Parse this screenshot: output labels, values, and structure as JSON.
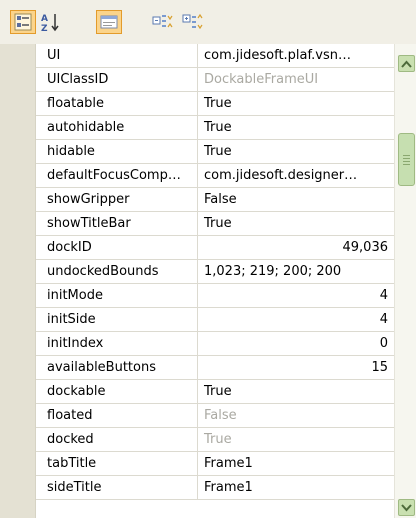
{
  "toolbar": {
    "buttons": [
      {
        "icon": "categorized-icon",
        "active": true
      },
      {
        "icon": "sort-alphabetical-icon",
        "active": false
      },
      {
        "icon": "description-toggle-icon",
        "active": true
      },
      {
        "icon": "expand-all-icon",
        "active": false
      },
      {
        "icon": "collapse-all-icon",
        "active": false
      }
    ]
  },
  "grid": {
    "rows": [
      {
        "name": "UI",
        "value": "com.jidesoft.plaf.vsn…",
        "align": "left",
        "gray": false
      },
      {
        "name": "UIClassID",
        "value": "DockableFrameUI",
        "align": "left",
        "gray": true
      },
      {
        "name": "floatable",
        "value": "True",
        "align": "left",
        "gray": false
      },
      {
        "name": "autohidable",
        "value": "True",
        "align": "left",
        "gray": false
      },
      {
        "name": "hidable",
        "value": "True",
        "align": "left",
        "gray": false
      },
      {
        "name": "defaultFocusComp…",
        "value": "com.jidesoft.designer…",
        "align": "left",
        "gray": false
      },
      {
        "name": "showGripper",
        "value": "False",
        "align": "left",
        "gray": false
      },
      {
        "name": "showTitleBar",
        "value": "True",
        "align": "left",
        "gray": false
      },
      {
        "name": "dockID",
        "value": "49,036",
        "align": "right",
        "gray": false
      },
      {
        "name": "undockedBounds",
        "value": "1,023; 219; 200; 200",
        "align": "left",
        "gray": false
      },
      {
        "name": "initMode",
        "value": "4",
        "align": "right",
        "gray": false
      },
      {
        "name": "initSide",
        "value": "4",
        "align": "right",
        "gray": false
      },
      {
        "name": "initIndex",
        "value": "0",
        "align": "right",
        "gray": false
      },
      {
        "name": "availableButtons",
        "value": "15",
        "align": "right",
        "gray": false
      },
      {
        "name": "dockable",
        "value": "True",
        "align": "left",
        "gray": false
      },
      {
        "name": "floated",
        "value": "False",
        "align": "left",
        "gray": true
      },
      {
        "name": "docked",
        "value": "True",
        "align": "left",
        "gray": true
      },
      {
        "name": "tabTitle",
        "value": "Frame1",
        "align": "left",
        "gray": false
      },
      {
        "name": "sideTitle",
        "value": "Frame1",
        "align": "left",
        "gray": false
      }
    ]
  },
  "colors": {
    "toolbar_bg": "#f1efe6",
    "gutter_bg": "#e4e1d3",
    "active_button_bg": "#fbd48b",
    "scrollbar_green": "#c6dfb0",
    "disabled_text": "#aaa9a2"
  }
}
